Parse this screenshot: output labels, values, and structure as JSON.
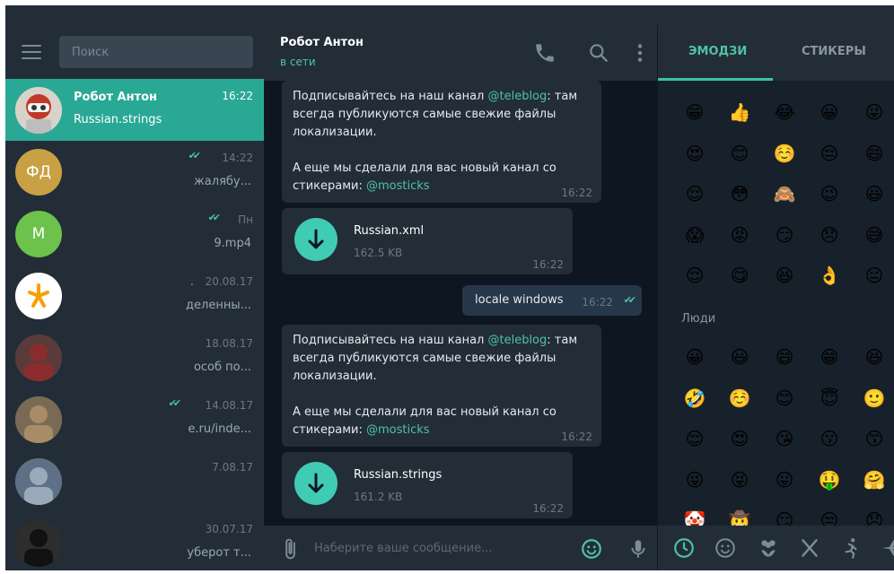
{
  "sidebar": {
    "search_placeholder": "Поиск",
    "chats": [
      {
        "name": "Робот Антон",
        "time": "16:22",
        "preview": "Russian.strings",
        "active": true
      },
      {
        "initials": "ФД",
        "color": "#c9a043",
        "time": "14:22",
        "preview": "жалябу...",
        "checks": "✔✔"
      },
      {
        "initials": "M",
        "color": "#6cc24a",
        "time": "Пн",
        "preview": "9.mp4",
        "checks": "✔✔"
      },
      {
        "color": "#ffffff",
        "time": "20.08.17",
        "preview": "деленны...",
        "dot": "."
      },
      {
        "color": "#5a3b3b",
        "time": "18.08.17",
        "preview": "особ по..."
      },
      {
        "color": "#7a6a55",
        "time": "14.08.17",
        "preview": "e.ru/inde...",
        "checks": "✔✔"
      },
      {
        "color": "#5d7085",
        "time": "7.08.17",
        "preview": ""
      },
      {
        "color": "#2d2d2d",
        "time": "30.07.17",
        "preview": "уберот т..."
      }
    ]
  },
  "chat": {
    "name": "Робот Антон",
    "status": "в сети",
    "messages": [
      {
        "type": "text",
        "lines": [
          "Подписывайтесь на наш канал ",
          "@teleblog",
          ": там",
          "всегда публикуются самые свежие файлы",
          "локализации.",
          "",
          "А еще мы сделали для вас новый канал со",
          "стикерами: ",
          "@mosticks"
        ],
        "time": "16:22"
      },
      {
        "type": "file",
        "name": "Russian.xml",
        "size": "162.5 KB",
        "time": "16:22"
      },
      {
        "type": "out",
        "text": "locale windows",
        "time": "16:22"
      },
      {
        "type": "text",
        "lines": [
          "Подписывайтесь на наш канал ",
          "@teleblog",
          ": там",
          "всегда публикуются самые свежие файлы",
          "локализации.",
          "",
          "А еще мы сделали для вас новый канал со",
          "стикерами: ",
          "@mosticks"
        ],
        "time": "16:22"
      },
      {
        "type": "file",
        "name": "Russian.strings",
        "size": "161.2 KB",
        "time": "16:22"
      }
    ],
    "compose_placeholder": "Наберите ваше сообщение..."
  },
  "emoji_panel": {
    "tab_emoji": "ЭМОДЗИ",
    "tab_stickers": "СТИКЕРЫ",
    "section_people": "Люди",
    "recent": [
      "😁",
      "👍",
      "😂",
      "😀",
      "😜",
      "😍",
      "😊",
      "☺️",
      "😔",
      "😄",
      "😌",
      "😳",
      "🙈",
      "😉",
      "😃",
      "😱",
      "😡",
      "😏",
      "😞",
      "😅",
      "😌",
      "😋",
      "😆",
      "👌",
      "😐"
    ],
    "people": [
      "😀",
      "😃",
      "😄",
      "😁",
      "😆",
      "🤣",
      "☺️",
      "😊",
      "😇",
      "🙂",
      "😌",
      "😍",
      "😘",
      "😗",
      "😙",
      "😜",
      "😝",
      "😛",
      "🤑",
      "🤗",
      "🤡",
      "🤠",
      "😏",
      "😒",
      "😞"
    ]
  },
  "colors": {
    "accent": "#2aa896",
    "link": "#4fc3a1",
    "bubble": "#232d38",
    "background": "#0e1621"
  }
}
